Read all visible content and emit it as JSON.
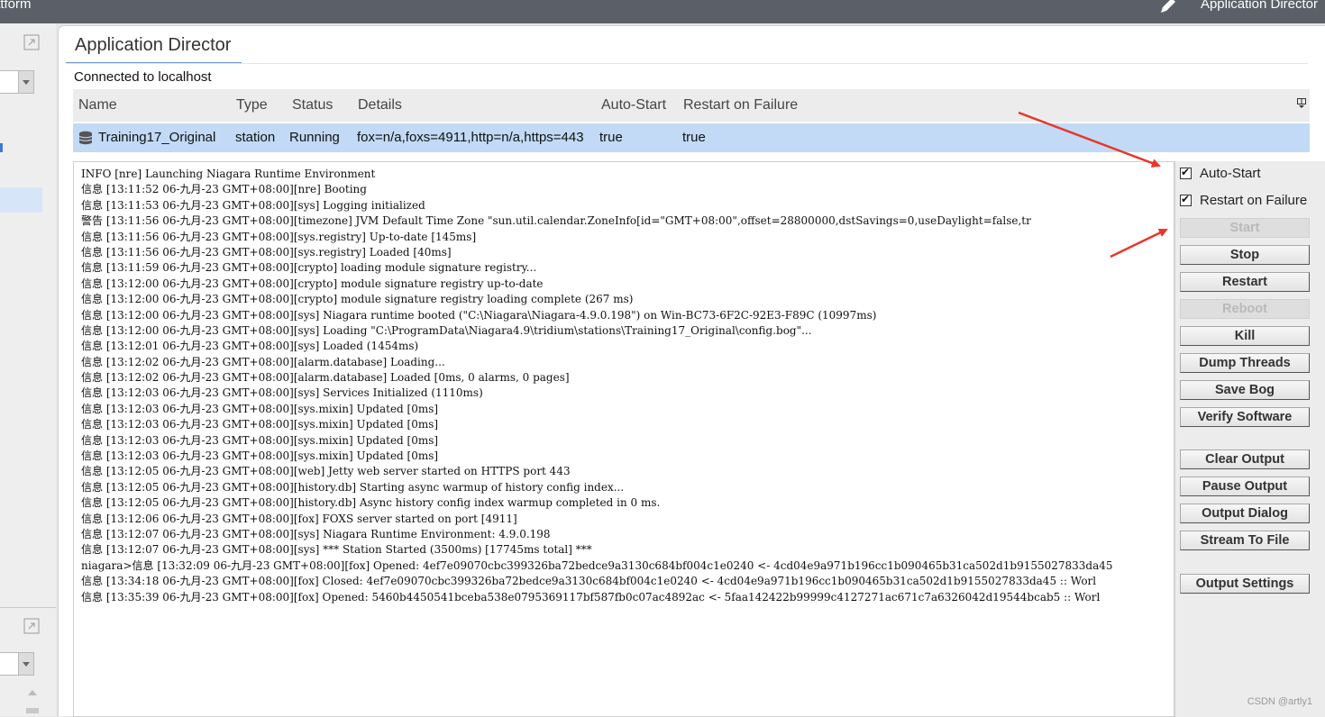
{
  "window": {
    "left_title": "atform",
    "right_title": "Application Director"
  },
  "tab": {
    "label": "Application Director"
  },
  "connection": {
    "status_text": "Connected to localhost"
  },
  "table": {
    "columns": [
      "Name",
      "Type",
      "Status",
      "Details",
      "Auto-Start",
      "Restart on Failure"
    ],
    "rows": [
      {
        "name": "Training17_Original",
        "type": "station",
        "status": "Running",
        "details": "fox=n/a,foxs=4911,http=n/a,https=443",
        "auto_start": "true",
        "restart_on_failure": "true",
        "icon": "database-icon"
      }
    ]
  },
  "console": {
    "lines": [
      "INFO [nre] Launching Niagara Runtime Environment",
      "信息 [13:11:52 06-九月-23 GMT+08:00][nre] Booting",
      "信息 [13:11:53 06-九月-23 GMT+08:00][sys] Logging initialized",
      "警告 [13:11:56 06-九月-23 GMT+08:00][timezone] JVM Default Time Zone \"sun.util.calendar.ZoneInfo[id=\"GMT+08:00\",offset=28800000,dstSavings=0,useDaylight=false,tr",
      "信息 [13:11:56 06-九月-23 GMT+08:00][sys.registry] Up-to-date [145ms]",
      "信息 [13:11:56 06-九月-23 GMT+08:00][sys.registry] Loaded [40ms]",
      "信息 [13:11:59 06-九月-23 GMT+08:00][crypto] loading module signature registry...",
      "信息 [13:12:00 06-九月-23 GMT+08:00][crypto] module signature registry up-to-date",
      "信息 [13:12:00 06-九月-23 GMT+08:00][crypto] module signature registry loading complete (267 ms)",
      "信息 [13:12:00 06-九月-23 GMT+08:00][sys] Niagara runtime booted (\"C:\\Niagara\\Niagara-4.9.0.198\") on Win-BC73-6F2C-92E3-F89C (10997ms)",
      "信息 [13:12:00 06-九月-23 GMT+08:00][sys] Loading \"C:\\ProgramData\\Niagara4.9\\tridium\\stations\\Training17_Original\\config.bog\"...",
      "信息 [13:12:01 06-九月-23 GMT+08:00][sys] Loaded (1454ms)",
      "信息 [13:12:02 06-九月-23 GMT+08:00][alarm.database] Loading...",
      "信息 [13:12:02 06-九月-23 GMT+08:00][alarm.database] Loaded [0ms, 0 alarms, 0 pages]",
      "信息 [13:12:03 06-九月-23 GMT+08:00][sys] Services Initialized (1110ms)",
      "信息 [13:12:03 06-九月-23 GMT+08:00][sys.mixin] Updated [0ms]",
      "信息 [13:12:03 06-九月-23 GMT+08:00][sys.mixin] Updated [0ms]",
      "信息 [13:12:03 06-九月-23 GMT+08:00][sys.mixin] Updated [0ms]",
      "信息 [13:12:03 06-九月-23 GMT+08:00][sys.mixin] Updated [0ms]",
      "信息 [13:12:05 06-九月-23 GMT+08:00][web] Jetty web server started on HTTPS port 443",
      "信息 [13:12:05 06-九月-23 GMT+08:00][history.db] Starting async warmup of history config index...",
      "信息 [13:12:05 06-九月-23 GMT+08:00][history.db] Async history config index warmup completed in 0 ms.",
      "信息 [13:12:06 06-九月-23 GMT+08:00][fox] FOXS server started on port [4911]",
      "信息 [13:12:07 06-九月-23 GMT+08:00][sys] Niagara Runtime Environment: 4.9.0.198",
      "信息 [13:12:07 06-九月-23 GMT+08:00][sys] *** Station Started (3500ms) [17745ms total] ***",
      "niagara>信息 [13:32:09 06-九月-23 GMT+08:00][fox] Opened: 4ef7e09070cbc399326ba72bedce9a3130c684bf004c1e0240 <- 4cd04e9a971b196cc1b090465b31ca502d1b9155027833da45",
      "信息 [13:34:18 06-九月-23 GMT+08:00][fox] Closed: 4ef7e09070cbc399326ba72bedce9a3130c684bf004c1e0240 <- 4cd04e9a971b196cc1b090465b31ca502d1b9155027833da45 :: Worl",
      "信息 [13:35:39 06-九月-23 GMT+08:00][fox] Opened: 5460b4450541bceba538e0795369117bf587fb0c07ac4892ac <- 5faa142422b99999c4127271ac671c7a6326042d19544bcab5 :: Worl"
    ]
  },
  "side_panel": {
    "auto_start_label": "Auto-Start",
    "restart_on_failure_label": "Restart on Failure",
    "auto_start_checked": true,
    "restart_on_failure_checked": true,
    "buttons": {
      "start": "Start",
      "stop": "Stop",
      "restart": "Restart",
      "reboot": "Reboot",
      "kill": "Kill",
      "dump_threads": "Dump Threads",
      "save_bog": "Save Bog",
      "verify_software": "Verify Software",
      "clear_output": "Clear Output",
      "pause_output": "Pause Output",
      "output_dialog": "Output Dialog",
      "stream_to_file": "Stream To File",
      "output_settings": "Output Settings"
    }
  },
  "watermark": "CSDN @artly1",
  "colors": {
    "selection": "#c2daf5",
    "annotation_arrow": "#e8362b",
    "topbar": "#5b6068"
  }
}
